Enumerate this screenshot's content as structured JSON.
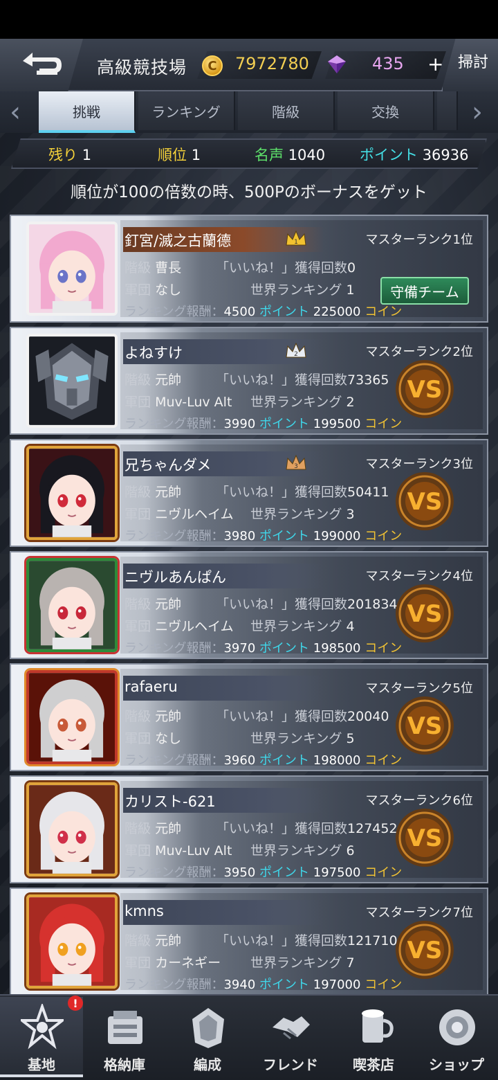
{
  "header": {
    "title": "高級競技場",
    "coins": "7972780",
    "gems": "435",
    "plus_label": "+",
    "sweep_label": "掃討"
  },
  "tabs": [
    {
      "label": "挑戦",
      "active": true
    },
    {
      "label": "ランキング",
      "active": false
    },
    {
      "label": "階級",
      "active": false
    },
    {
      "label": "交換",
      "active": false
    }
  ],
  "stats": {
    "remaining_label": "残り",
    "remaining_value": "1",
    "rank_label": "順位",
    "rank_value": "1",
    "fame_label": "名声",
    "fame_value": "1040",
    "points_label": "ポイント",
    "points_value": "36936"
  },
  "notice": "順位が100の倍数の時、500Pのボーナスをゲット",
  "labels": {
    "class": "階級",
    "likes": "「いいね！」獲得回数",
    "corps": "軍団",
    "world_rank": "世界ランキング",
    "reward": "ランキング報酬：",
    "points": "ポイント",
    "coins": "コイン",
    "defense_team": "守備チーム"
  },
  "players": [
    {
      "name": "釘宮/滅之古蘭德",
      "master_rank": "マスターランク1位",
      "class": "曹長",
      "likes": "0",
      "corps": "なし",
      "world_rank": "1",
      "reward_points": "4500",
      "reward_coins": "225000",
      "crown": "1",
      "is_self": true
    },
    {
      "name": "よねすけ",
      "master_rank": "マスターランク2位",
      "class": "元帥",
      "likes": "73365",
      "corps": "Muv-Luv Alt",
      "world_rank": "2",
      "reward_points": "3990",
      "reward_coins": "199500",
      "crown": "2",
      "is_self": false
    },
    {
      "name": "兄ちゃんダメ",
      "master_rank": "マスターランク3位",
      "class": "元帥",
      "likes": "50411",
      "corps": "ニヴルヘイム",
      "world_rank": "3",
      "reward_points": "3980",
      "reward_coins": "199000",
      "crown": "3",
      "is_self": false
    },
    {
      "name": "ニヴルあんぱん",
      "master_rank": "マスターランク4位",
      "class": "元帥",
      "likes": "201834",
      "corps": "ニヴルヘイム",
      "world_rank": "4",
      "reward_points": "3970",
      "reward_coins": "198500",
      "crown": "",
      "is_self": false
    },
    {
      "name": "rafaeru",
      "master_rank": "マスターランク5位",
      "class": "元帥",
      "likes": "20040",
      "corps": "なし",
      "world_rank": "5",
      "reward_points": "3960",
      "reward_coins": "198000",
      "crown": "",
      "is_self": false
    },
    {
      "name": "カリスト-621",
      "master_rank": "マスターランク6位",
      "class": "元帥",
      "likes": "127452",
      "corps": "Muv-Luv Alt",
      "world_rank": "6",
      "reward_points": "3950",
      "reward_coins": "197500",
      "crown": "",
      "is_self": false
    },
    {
      "name": "kmns",
      "master_rank": "マスターランク7位",
      "class": "元帥",
      "likes": "121710",
      "corps": "カーネギー",
      "world_rank": "7",
      "reward_points": "3940",
      "reward_coins": "197000",
      "crown": "",
      "is_self": false
    }
  ],
  "nav": [
    {
      "label": "基地",
      "icon": "base-icon",
      "active": true,
      "badge": "!"
    },
    {
      "label": "格納庫",
      "icon": "hangar-icon",
      "active": false
    },
    {
      "label": "編成",
      "icon": "formation-icon",
      "active": false
    },
    {
      "label": "フレンド",
      "icon": "friend-icon",
      "active": false
    },
    {
      "label": "喫茶店",
      "icon": "cafe-icon",
      "active": false
    },
    {
      "label": "ショップ",
      "icon": "shop-icon",
      "active": false
    }
  ],
  "colors": {
    "coin": "#f3cf52",
    "gem": "#e8a6f0",
    "points": "#3fd7ea",
    "reward_coins": "#f0c234",
    "tab_active_underline": "#5ed0f0"
  }
}
